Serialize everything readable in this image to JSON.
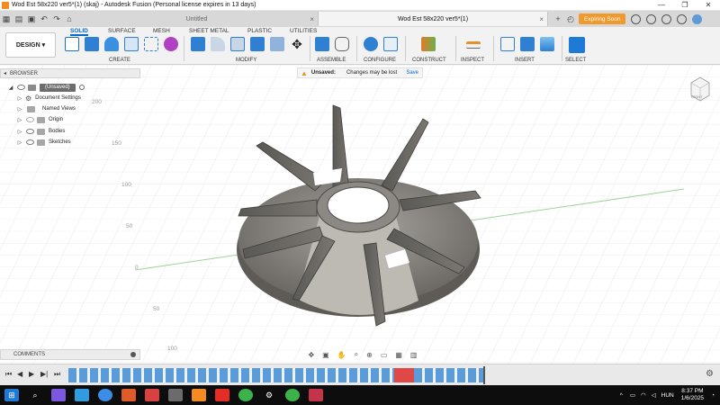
{
  "window": {
    "title": "Wod Est 58x220 ver5*(1) (skaj) - Autodesk Fusion (Personal license expires in 13 days)",
    "minimize": "—",
    "maximize": "❐",
    "close": "✕"
  },
  "tabs": [
    {
      "label": "Untitled",
      "active": false
    },
    {
      "label": "Wod Est 58x220 ver5*(1)",
      "active": true
    }
  ],
  "topbar": {
    "expiring_label": "Expiring Soon",
    "plus": "+"
  },
  "ribbon": {
    "design_label": "DESIGN",
    "tabs": [
      "SOLID",
      "SURFACE",
      "MESH",
      "SHEET METAL",
      "PLASTIC",
      "UTILITIES"
    ],
    "groups": [
      "CREATE",
      "MODIFY",
      "ASSEMBLE",
      "CONFIGURE",
      "CONSTRUCT",
      "INSPECT",
      "INSERT",
      "SELECT"
    ]
  },
  "browser": {
    "header": "BROWSER",
    "root": "(Unsaved)",
    "items": [
      "Document Settings",
      "Named Views",
      "Origin",
      "Bodies",
      "Sketches"
    ]
  },
  "unsaved_bar": {
    "label": "Unsaved:",
    "message": "Changes may be lost",
    "save": "Save"
  },
  "comments_label": "COMMENTS",
  "viewcube_label": "RIGHT",
  "ruler_ticks": [
    "200",
    "150",
    "100",
    "50",
    "0",
    "50",
    "100"
  ],
  "taskbar": {
    "lang": "HUN",
    "time": "8:37 PM",
    "date": "1/6/2025"
  },
  "colors": {
    "accent": "#0a68c9",
    "expire": "#f09a2b",
    "model_metal": "#6d6a66",
    "model_light": "#bdbab4"
  }
}
